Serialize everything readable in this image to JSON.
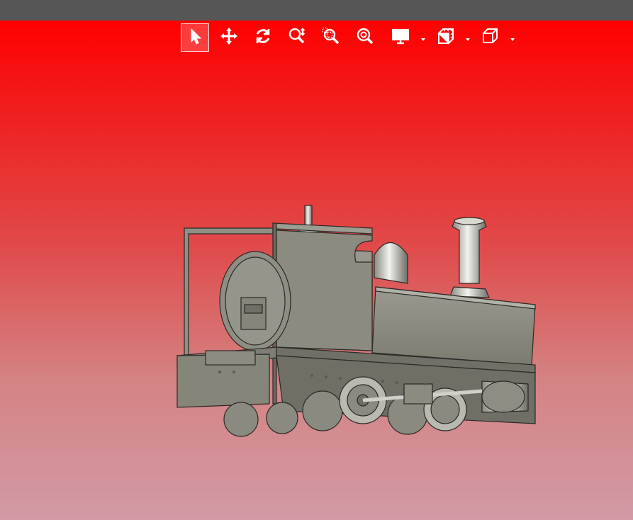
{
  "window": {
    "title_bar_color": "#565656"
  },
  "viewport": {
    "background_top": "#ff0000",
    "background_bottom": "#d29aa5",
    "model": {
      "description_name": "steam-locomotive-cad-model"
    }
  },
  "toolbar": {
    "tools": [
      {
        "name": "select",
        "icon": "cursor-arrow-icon",
        "active": true
      },
      {
        "name": "pan",
        "icon": "move-arrows-icon",
        "active": false
      },
      {
        "name": "rotate",
        "icon": "rotate-icon",
        "active": false
      },
      {
        "name": "zoom",
        "icon": "zoom-updown-icon",
        "active": false
      },
      {
        "name": "zoom-window",
        "icon": "zoom-window-icon",
        "active": false
      },
      {
        "name": "zoom-fit",
        "icon": "zoom-fit-icon",
        "active": false
      },
      {
        "name": "display",
        "icon": "monitor-icon",
        "active": false,
        "dropdown": true
      },
      {
        "name": "section",
        "icon": "section-view-icon",
        "active": false,
        "dropdown": true
      },
      {
        "name": "view-orientation",
        "icon": "cube-view-icon",
        "active": false,
        "dropdown": true
      }
    ]
  }
}
